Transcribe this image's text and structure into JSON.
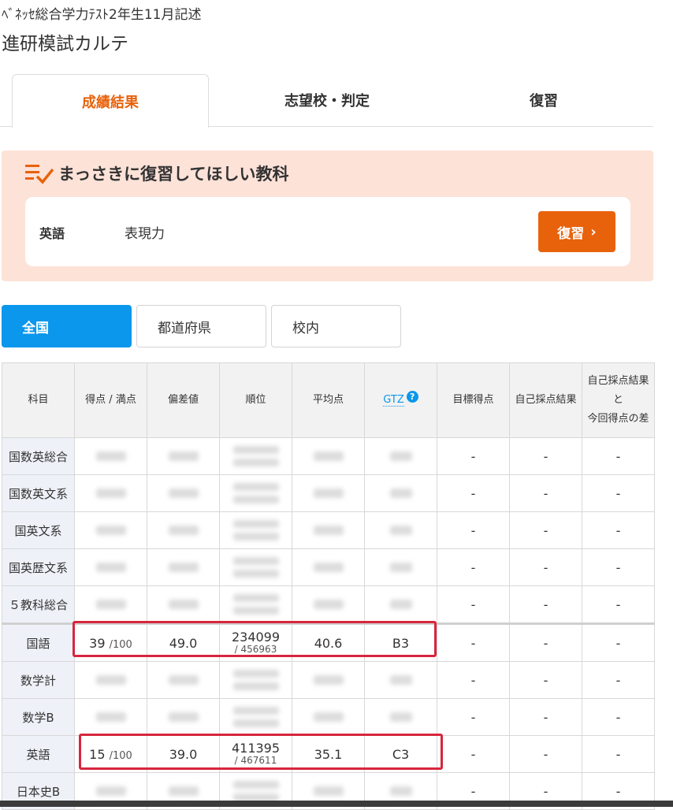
{
  "page": {
    "subtitle": "ﾍﾞﾈｯｾ総合学力ﾃｽﾄ2年生11月記述",
    "title": "進研模試カルテ"
  },
  "tabs": [
    "成績結果",
    "志望校・判定",
    "復習"
  ],
  "review": {
    "title": "まっさきに復習してほしい教科",
    "subject": "英語",
    "field": "表現力",
    "button_label": "復習",
    "button_chevron": "›"
  },
  "region_tabs": [
    "全国",
    "都道府県",
    "校内"
  ],
  "table": {
    "headers": {
      "subject": "科目",
      "score": "得点 / 満点",
      "deviation": "偏差値",
      "rank": "順位",
      "average": "平均点",
      "gtz": "GTZ",
      "gtz_help": "?",
      "target": "目標得点",
      "self_score": "自己採点結果",
      "diff_line1": "自己採点結果",
      "diff_line2": "と",
      "diff_line3": "今回得点の差"
    },
    "dash": "-",
    "rows": [
      {
        "subject": "国数英総合"
      },
      {
        "subject": "国数英文系"
      },
      {
        "subject": "国英文系"
      },
      {
        "subject": "国英歴文系"
      },
      {
        "subject": "５教科総合"
      },
      {
        "subject": "国語",
        "score": "39",
        "max": "/100",
        "deviation": "49.0",
        "rank": "234099",
        "total": "/ 456963",
        "average": "40.6",
        "gtz": "B3"
      },
      {
        "subject": "数学計"
      },
      {
        "subject": "数学B"
      },
      {
        "subject": "英語",
        "score": "15",
        "max": "/100",
        "deviation": "39.0",
        "rank": "411395",
        "total": "/ 467611",
        "average": "35.1",
        "gtz": "C3"
      },
      {
        "subject": "日本史B"
      }
    ]
  },
  "colors": {
    "accent_orange": "#e8620c",
    "accent_blue": "#0a97ec",
    "review_bg": "#fde2d8",
    "highlight_red": "#d7263d"
  },
  "icons": {
    "review": "checklist-icon",
    "button": "chevron-right-icon",
    "help": "question-circle-icon"
  }
}
